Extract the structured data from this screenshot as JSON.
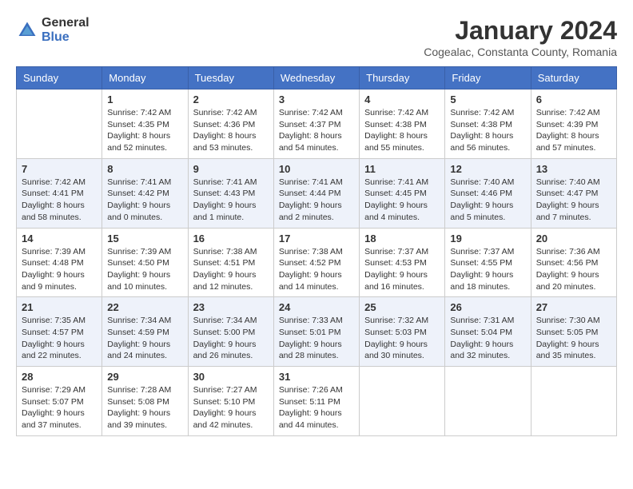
{
  "header": {
    "logo_general": "General",
    "logo_blue": "Blue",
    "month_title": "January 2024",
    "subtitle": "Cogealac, Constanta County, Romania"
  },
  "columns": [
    "Sunday",
    "Monday",
    "Tuesday",
    "Wednesday",
    "Thursday",
    "Friday",
    "Saturday"
  ],
  "weeks": [
    {
      "days": [
        {
          "number": "",
          "sunrise": "",
          "sunset": "",
          "daylight": ""
        },
        {
          "number": "1",
          "sunrise": "Sunrise: 7:42 AM",
          "sunset": "Sunset: 4:35 PM",
          "daylight": "Daylight: 8 hours and 52 minutes."
        },
        {
          "number": "2",
          "sunrise": "Sunrise: 7:42 AM",
          "sunset": "Sunset: 4:36 PM",
          "daylight": "Daylight: 8 hours and 53 minutes."
        },
        {
          "number": "3",
          "sunrise": "Sunrise: 7:42 AM",
          "sunset": "Sunset: 4:37 PM",
          "daylight": "Daylight: 8 hours and 54 minutes."
        },
        {
          "number": "4",
          "sunrise": "Sunrise: 7:42 AM",
          "sunset": "Sunset: 4:38 PM",
          "daylight": "Daylight: 8 hours and 55 minutes."
        },
        {
          "number": "5",
          "sunrise": "Sunrise: 7:42 AM",
          "sunset": "Sunset: 4:38 PM",
          "daylight": "Daylight: 8 hours and 56 minutes."
        },
        {
          "number": "6",
          "sunrise": "Sunrise: 7:42 AM",
          "sunset": "Sunset: 4:39 PM",
          "daylight": "Daylight: 8 hours and 57 minutes."
        }
      ]
    },
    {
      "days": [
        {
          "number": "7",
          "sunrise": "Sunrise: 7:42 AM",
          "sunset": "Sunset: 4:41 PM",
          "daylight": "Daylight: 8 hours and 58 minutes."
        },
        {
          "number": "8",
          "sunrise": "Sunrise: 7:41 AM",
          "sunset": "Sunset: 4:42 PM",
          "daylight": "Daylight: 9 hours and 0 minutes."
        },
        {
          "number": "9",
          "sunrise": "Sunrise: 7:41 AM",
          "sunset": "Sunset: 4:43 PM",
          "daylight": "Daylight: 9 hours and 1 minute."
        },
        {
          "number": "10",
          "sunrise": "Sunrise: 7:41 AM",
          "sunset": "Sunset: 4:44 PM",
          "daylight": "Daylight: 9 hours and 2 minutes."
        },
        {
          "number": "11",
          "sunrise": "Sunrise: 7:41 AM",
          "sunset": "Sunset: 4:45 PM",
          "daylight": "Daylight: 9 hours and 4 minutes."
        },
        {
          "number": "12",
          "sunrise": "Sunrise: 7:40 AM",
          "sunset": "Sunset: 4:46 PM",
          "daylight": "Daylight: 9 hours and 5 minutes."
        },
        {
          "number": "13",
          "sunrise": "Sunrise: 7:40 AM",
          "sunset": "Sunset: 4:47 PM",
          "daylight": "Daylight: 9 hours and 7 minutes."
        }
      ]
    },
    {
      "days": [
        {
          "number": "14",
          "sunrise": "Sunrise: 7:39 AM",
          "sunset": "Sunset: 4:48 PM",
          "daylight": "Daylight: 9 hours and 9 minutes."
        },
        {
          "number": "15",
          "sunrise": "Sunrise: 7:39 AM",
          "sunset": "Sunset: 4:50 PM",
          "daylight": "Daylight: 9 hours and 10 minutes."
        },
        {
          "number": "16",
          "sunrise": "Sunrise: 7:38 AM",
          "sunset": "Sunset: 4:51 PM",
          "daylight": "Daylight: 9 hours and 12 minutes."
        },
        {
          "number": "17",
          "sunrise": "Sunrise: 7:38 AM",
          "sunset": "Sunset: 4:52 PM",
          "daylight": "Daylight: 9 hours and 14 minutes."
        },
        {
          "number": "18",
          "sunrise": "Sunrise: 7:37 AM",
          "sunset": "Sunset: 4:53 PM",
          "daylight": "Daylight: 9 hours and 16 minutes."
        },
        {
          "number": "19",
          "sunrise": "Sunrise: 7:37 AM",
          "sunset": "Sunset: 4:55 PM",
          "daylight": "Daylight: 9 hours and 18 minutes."
        },
        {
          "number": "20",
          "sunrise": "Sunrise: 7:36 AM",
          "sunset": "Sunset: 4:56 PM",
          "daylight": "Daylight: 9 hours and 20 minutes."
        }
      ]
    },
    {
      "days": [
        {
          "number": "21",
          "sunrise": "Sunrise: 7:35 AM",
          "sunset": "Sunset: 4:57 PM",
          "daylight": "Daylight: 9 hours and 22 minutes."
        },
        {
          "number": "22",
          "sunrise": "Sunrise: 7:34 AM",
          "sunset": "Sunset: 4:59 PM",
          "daylight": "Daylight: 9 hours and 24 minutes."
        },
        {
          "number": "23",
          "sunrise": "Sunrise: 7:34 AM",
          "sunset": "Sunset: 5:00 PM",
          "daylight": "Daylight: 9 hours and 26 minutes."
        },
        {
          "number": "24",
          "sunrise": "Sunrise: 7:33 AM",
          "sunset": "Sunset: 5:01 PM",
          "daylight": "Daylight: 9 hours and 28 minutes."
        },
        {
          "number": "25",
          "sunrise": "Sunrise: 7:32 AM",
          "sunset": "Sunset: 5:03 PM",
          "daylight": "Daylight: 9 hours and 30 minutes."
        },
        {
          "number": "26",
          "sunrise": "Sunrise: 7:31 AM",
          "sunset": "Sunset: 5:04 PM",
          "daylight": "Daylight: 9 hours and 32 minutes."
        },
        {
          "number": "27",
          "sunrise": "Sunrise: 7:30 AM",
          "sunset": "Sunset: 5:05 PM",
          "daylight": "Daylight: 9 hours and 35 minutes."
        }
      ]
    },
    {
      "days": [
        {
          "number": "28",
          "sunrise": "Sunrise: 7:29 AM",
          "sunset": "Sunset: 5:07 PM",
          "daylight": "Daylight: 9 hours and 37 minutes."
        },
        {
          "number": "29",
          "sunrise": "Sunrise: 7:28 AM",
          "sunset": "Sunset: 5:08 PM",
          "daylight": "Daylight: 9 hours and 39 minutes."
        },
        {
          "number": "30",
          "sunrise": "Sunrise: 7:27 AM",
          "sunset": "Sunset: 5:10 PM",
          "daylight": "Daylight: 9 hours and 42 minutes."
        },
        {
          "number": "31",
          "sunrise": "Sunrise: 7:26 AM",
          "sunset": "Sunset: 5:11 PM",
          "daylight": "Daylight: 9 hours and 44 minutes."
        },
        {
          "number": "",
          "sunrise": "",
          "sunset": "",
          "daylight": ""
        },
        {
          "number": "",
          "sunrise": "",
          "sunset": "",
          "daylight": ""
        },
        {
          "number": "",
          "sunrise": "",
          "sunset": "",
          "daylight": ""
        }
      ]
    }
  ]
}
